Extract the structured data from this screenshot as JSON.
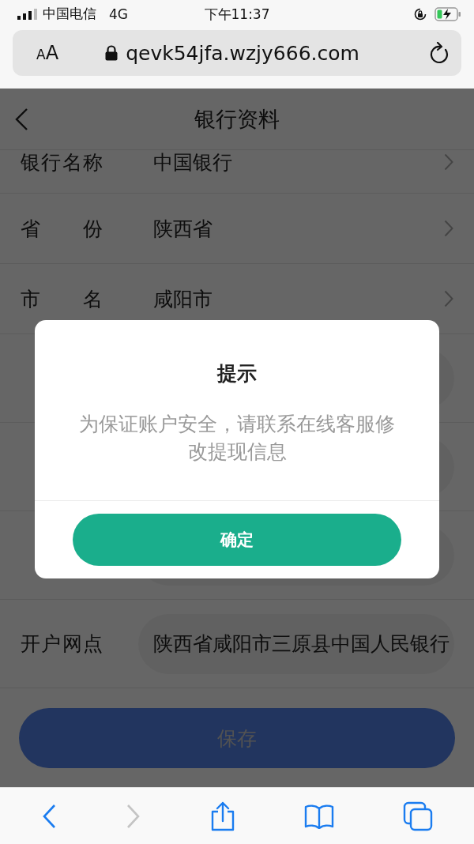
{
  "status_bar": {
    "carrier": "中国电信",
    "network": "4G",
    "time": "下午11:37"
  },
  "browser": {
    "text_size": "AA",
    "url": "qevk54jfa.wzjy666.com"
  },
  "header": {
    "title": "银行资料"
  },
  "rows": [
    {
      "kind": "select",
      "label": "银行名称",
      "value": "中国银行"
    },
    {
      "kind": "select",
      "label": "省份",
      "value": "陕西省"
    },
    {
      "kind": "select",
      "label": "市名",
      "value": "咸阳市"
    },
    {
      "kind": "input"
    },
    {
      "kind": "input"
    },
    {
      "kind": "input"
    },
    {
      "kind": "input",
      "label": "开户网点",
      "value": "陕西省咸阳市三原县中国人民银行"
    }
  ],
  "save_button": {
    "label": "保存"
  },
  "dialog": {
    "title": "提示",
    "message": "为保证账户安全，请联系在线客服修改提现信息",
    "confirm": "确定"
  },
  "toolbar": {
    "forward_disabled": true
  }
}
